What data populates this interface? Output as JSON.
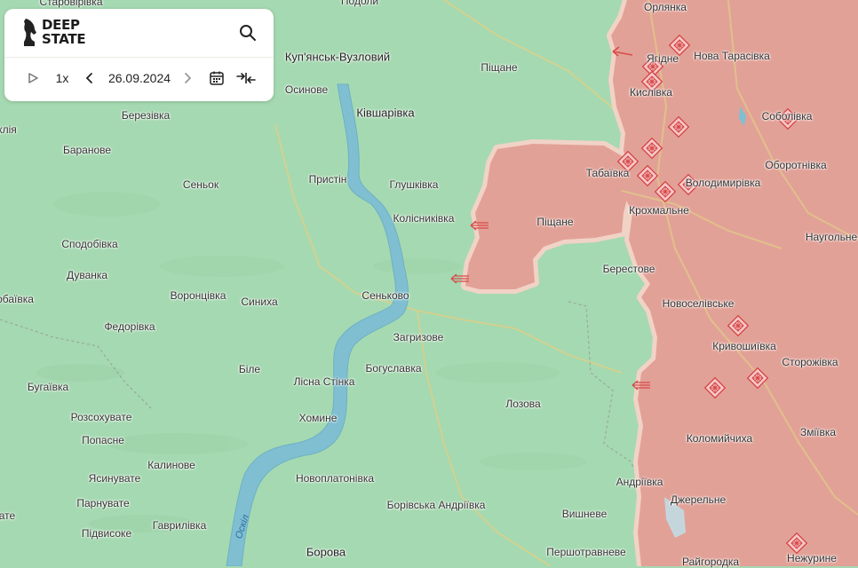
{
  "app": {
    "logo_text_line1": "DEEP",
    "logo_text_line2": "STATE",
    "icons": [
      "horse-logo-icon",
      "search-icon",
      "play-icon",
      "chevron-left-icon",
      "chevron-right-icon",
      "calendar-icon",
      "collapse-icon"
    ]
  },
  "controls": {
    "speed": "1x",
    "date": "26.09.2024"
  },
  "colors": {
    "land": "#a5d9b1",
    "occupied": "#e2a197",
    "occupied_border": "#f1d3c6",
    "water": "#7fbfd1",
    "marker": "#e64b4b"
  },
  "places": {
    "orlianka": "Орлянка",
    "yagidne": "Ягідне",
    "nova_tarasivka": "Нова Тарасівка",
    "kupiansk_vuzlovyi": "Куп'янськ-Вузловий",
    "pishchane_n": "Піщане",
    "osynove": "Осинове",
    "kivsharivka": "Ківшарівка",
    "kyslivka": "Кислівка",
    "berezivka": "Березівка",
    "kliia": "клія",
    "soboliv": "Соболівка",
    "baranove": "Баранове",
    "tabaivka": "Табаївка",
    "oborotnivka": "Оборотнівка",
    "senok": "Сеньок",
    "prystyn": "Пристін",
    "glushkivka": "Глушківка",
    "volodymyrivka": "Володимирівка",
    "krokhmalne": "Крохмальне",
    "kolisnykivka": "Колісниківка",
    "pishchane_s": "Піщане",
    "naugolne": "Наугольне",
    "spodobivka": "Сподобівка",
    "dovanka": "Дуванка",
    "berestove": "Берестове",
    "vorontsivka": "Воронцівка",
    "synikha": "Синиха",
    "senkove": "Сеньково",
    "obaivka": "обаївка",
    "novoselivske": "Новоселівське",
    "fedorivka": "Федорівка",
    "zagryzove": "Загризове",
    "kryvoshyivka": "Кривошиївка",
    "bile": "Біле",
    "storozhivka": "Сторожівка",
    "bogoslavka": "Богуславка",
    "bugaivka": "Бугаївка",
    "lisna_stinka": "Лісна Стінка",
    "lozova": "Лозова",
    "rozsokhuvate": "Розсохувате",
    "khomyne": "Хомине",
    "zmiivka": "Зміївка",
    "popasne": "Попасне",
    "kolomyichykha": "Коломийчиха",
    "kalynove": "Калинове",
    "yasynuvate": "Ясинувате",
    "novoplatonivka": "Новоплатонівка",
    "andriivka": "Андріївка",
    "dzherelne": "Джерельне",
    "parnuvate": "Парнувате",
    "borivska_andriivka": "Борівська Андріївка",
    "vyshneve": "Вишневе",
    "gavrylivka": "Гаврилівка",
    "pidvysoke": "Підвисоке",
    "pershotravneve": "Першотравневе",
    "nezhuryne": "Нежурине",
    "borova": "Борова",
    "raigorodka": "Райгородка",
    "podoly": "Подоли",
    "starovirivka": "Старовірівка",
    "dovanka_w": "ате"
  },
  "river": {
    "name": "Оскіл"
  }
}
